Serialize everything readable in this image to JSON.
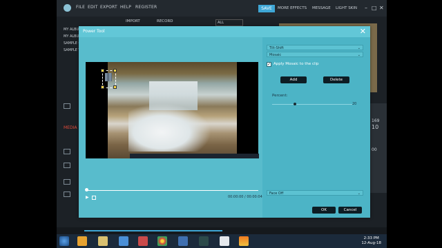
{
  "menu": {
    "file": "FILE",
    "edit": "EDIT",
    "export": "EXPORT",
    "help": "HELP",
    "register": "REGISTER"
  },
  "right_menu": {
    "save": "SAVE",
    "more_effects": "MORE EFFECTS",
    "message": "MESSAGE",
    "light_skin": "LIGHT SKIN"
  },
  "tabs": {
    "import": "IMPORT",
    "record": "RECORD",
    "filter": "ALL"
  },
  "albums": [
    "MY ALBUM (1)",
    "MY ALBUM",
    "SAMPLE C",
    "SAMPLE V"
  ],
  "sidebar": {
    "media_label": "MEDIA"
  },
  "right_side": {
    "v1": "169",
    "v2": "10",
    "v3": "00"
  },
  "dialog": {
    "title": "Power Tool",
    "tool_select": "Tilt-Shift",
    "effect_select": "Mosaic",
    "apply_checkbox_label": "Apply Mosaic to the clip",
    "apply_checked": true,
    "add_label": "Add",
    "delete_label": "Delete",
    "percent_label": "Percent:",
    "percent_value": "20",
    "face_off_select": "Face Off",
    "ok_label": "OK",
    "cancel_label": "Cancel",
    "timecode": "00:00:00 / 00:00:04"
  },
  "taskbar": {
    "time": "2:33 PM",
    "date": "12-Aug-18"
  },
  "colors": {
    "accent": "#3fa7d6",
    "dialog": "#62c7d7",
    "media": "#e04a3a"
  }
}
